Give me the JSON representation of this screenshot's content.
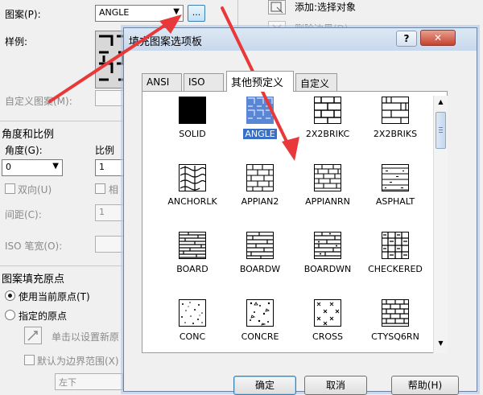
{
  "main": {
    "pattern_label": "图案(P):",
    "pattern_value": "ANGLE",
    "browse_label": "...",
    "sample_label": "样例:",
    "custom_pattern_label": "自定义图案(M):",
    "angle_scale_header": "角度和比例",
    "angle_label": "角度(G):",
    "angle_value": "0",
    "scale_label": "比例",
    "scale_value": "1",
    "double_label": "双向(U)",
    "relative_label": "相",
    "spacing_label": "间距(C):",
    "spacing_value": "1",
    "iso_pen_label": "ISO 笔宽(O):",
    "origin_header": "图案填充原点",
    "use_current_origin": "使用当前原点(T)",
    "specified_origin": "指定的原点",
    "click_set_origin": "单击以设置新原",
    "default_boundary": "默认为边界范围(X)",
    "position_value": "左下",
    "add_select_objects": "添加:选择对象",
    "remove_boundary": "删除边界(D)"
  },
  "dialog": {
    "title": "填充图案选项板",
    "help_glyph": "?",
    "close_glyph": "✕",
    "tabs": [
      "ANSI",
      "ISO",
      "其他预定义",
      "自定义"
    ],
    "active_tab": 2,
    "patterns": [
      "SOLID",
      "ANGLE",
      "2X2BRIKC",
      "2X2BRIKS",
      "ANCHORLK",
      "APPIAN2",
      "APPIANRN",
      "ASPHALT",
      "BOARD",
      "BOARDW",
      "BOARDWN",
      "CHECKERED",
      "CONC",
      "CONCRE",
      "CROSS",
      "CTYSQ6RN"
    ],
    "selected_pattern": "ANGLE",
    "ok_label": "确定",
    "cancel_label": "取消",
    "help_label": "帮助(H)"
  },
  "colors": {
    "arrow": "#e8383a",
    "selection": "#3b6fc6",
    "titlebar": "#c8d8ec"
  }
}
